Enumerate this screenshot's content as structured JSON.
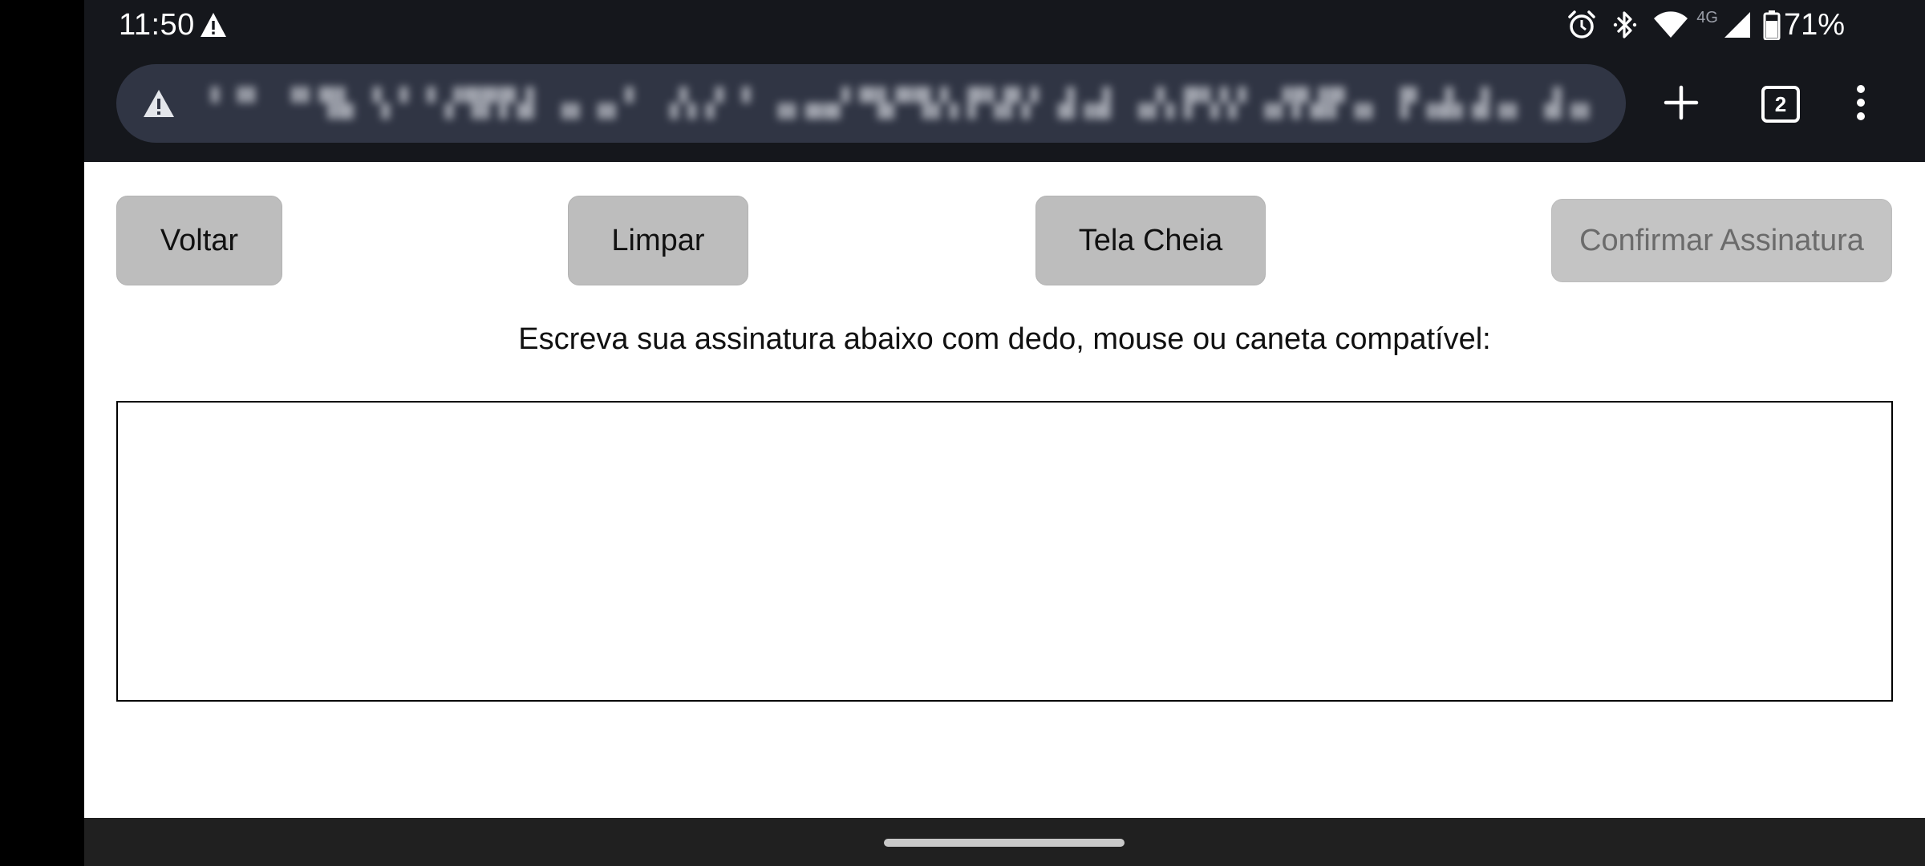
{
  "status_bar": {
    "time": "11:50",
    "battery": "71%",
    "network": "4G",
    "icons": [
      "warning-icon",
      "alarm-icon",
      "bluetooth-icon",
      "wifi-icon",
      "cellular-signal-icon",
      "battery-icon"
    ]
  },
  "browser": {
    "url_text": "▘▝▘ ▝▘▜▙ ▚▝ ▘▞▜▛▛▟ ▗▖▗▖▘ ▗▚▗▘▝ ▗▖▄▄▘▀▙▀▜▞▖▛▚▛▞ ▟▗▟ ▗▞▖▛▚▚▘▗▞▛▟▛▗▖ ▛▗▟▖▟▗▖ ▟▗▖",
    "tab_count": "2",
    "icons": [
      "omnibox-warning-icon",
      "new-tab-icon",
      "tab-switcher-icon",
      "more-menu-icon"
    ]
  },
  "page": {
    "buttons": {
      "voltar": "Voltar",
      "limpar": "Limpar",
      "tela_cheia": "Tela Cheia",
      "confirmar": "Confirmar Assinatura"
    },
    "instruction": "Escreva sua assinatura abaixo com dedo, mouse ou caneta compatível:"
  },
  "colors": {
    "system_bar": "#15171c",
    "omnibox": "#303544",
    "button": "#bdbdbd",
    "button_disabled_text": "#6b6b6b",
    "nav_bar": "#202020"
  }
}
